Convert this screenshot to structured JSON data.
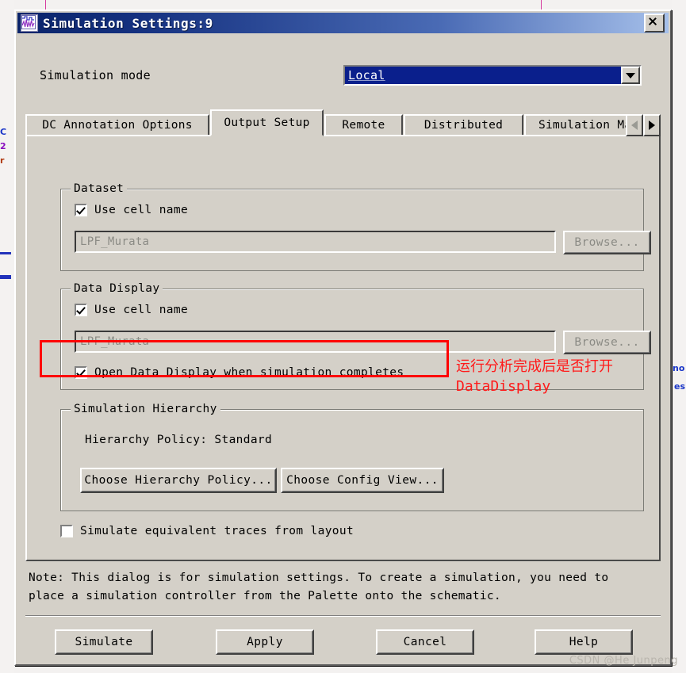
{
  "window": {
    "title": "Simulation Settings:9",
    "icon": "waveform-icon",
    "close_label": "✕"
  },
  "mode": {
    "label": "Simulation mode",
    "value": "Local",
    "options": [
      "Local"
    ]
  },
  "tabs": [
    {
      "label": "DC Annotation Options",
      "selected": false
    },
    {
      "label": "Output Setup",
      "selected": true
    },
    {
      "label": "Remote",
      "selected": false
    },
    {
      "label": "Distributed",
      "selected": false
    },
    {
      "label": "Simulation Ma",
      "selected": false
    }
  ],
  "tab_scroll": {
    "prev_icon": "triangle-left-icon",
    "next_icon": "triangle-right-icon"
  },
  "dataset_group": {
    "title": "Dataset",
    "use_cell_name_label": "Use cell name",
    "use_cell_name_checked": true,
    "path_value": "LPF_Murata",
    "browse_label": "Browse..."
  },
  "data_display_group": {
    "title": "Data Display",
    "use_cell_name_label": "Use cell name",
    "use_cell_name_checked": true,
    "path_value": "LPF_Murata",
    "browse_label": "Browse...",
    "open_on_complete_label": "Open Data Display when simulation completes",
    "open_on_complete_checked": true
  },
  "hierarchy_group": {
    "title": "Simulation Hierarchy",
    "policy_label": "Hierarchy Policy:  Standard",
    "choose_policy_label": "Choose Hierarchy Policy...",
    "choose_config_label": "Choose Config View..."
  },
  "simulate_traces": {
    "label": "Simulate equivalent traces from layout",
    "checked": false
  },
  "note": {
    "line1": "Note: This dialog is for simulation settings. To create a simulation, you need to",
    "line2": "place a simulation controller from the Palette onto the schematic."
  },
  "footer_buttons": {
    "simulate": "Simulate",
    "apply": "Apply",
    "cancel": "Cancel",
    "help": "Help"
  },
  "annotation": {
    "line1": "运行分析完成后是否打开",
    "line2": "DataDisplay",
    "color": "#ff1a1a"
  },
  "background": {
    "text_no": "no",
    "text_es": "es"
  },
  "watermark": "CSDN @He Junpeng"
}
